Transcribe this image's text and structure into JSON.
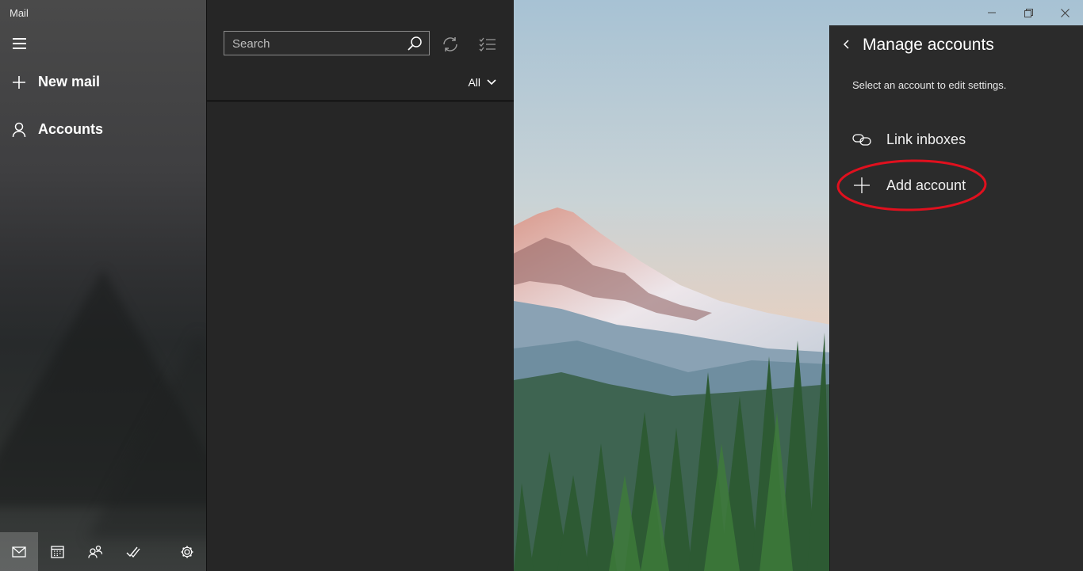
{
  "window": {
    "title": "Mail",
    "controls": [
      "minimize-icon",
      "restore-icon",
      "close-icon"
    ]
  },
  "nav": {
    "menu_icon": "hamburger-icon",
    "items": [
      {
        "label": "New mail",
        "icon": "plus-icon"
      },
      {
        "label": "Accounts",
        "icon": "person-icon"
      }
    ],
    "bottom_bar": [
      {
        "icon": "mail-icon",
        "active": true
      },
      {
        "icon": "calendar-icon",
        "active": false
      },
      {
        "icon": "people-icon",
        "active": false
      },
      {
        "icon": "todo-icon",
        "active": false
      },
      {
        "icon": "settings-gear-icon",
        "active": false
      }
    ]
  },
  "message_list": {
    "search": {
      "placeholder": "Search",
      "value": ""
    },
    "filter": {
      "selected": "All"
    }
  },
  "flyout": {
    "title": "Manage accounts",
    "subtitle": "Select an account to edit settings.",
    "items": [
      {
        "label": "Link inboxes",
        "icon": "link-icon"
      },
      {
        "label": "Add account",
        "icon": "plus-icon",
        "highlighted": true
      }
    ],
    "highlight_color": "#e0101e"
  },
  "colors": {
    "nav_bg": "#3f3f41",
    "list_bg": "#262626",
    "flyout_bg": "#2b2b2b",
    "accent_annotation": "#e0101e"
  }
}
